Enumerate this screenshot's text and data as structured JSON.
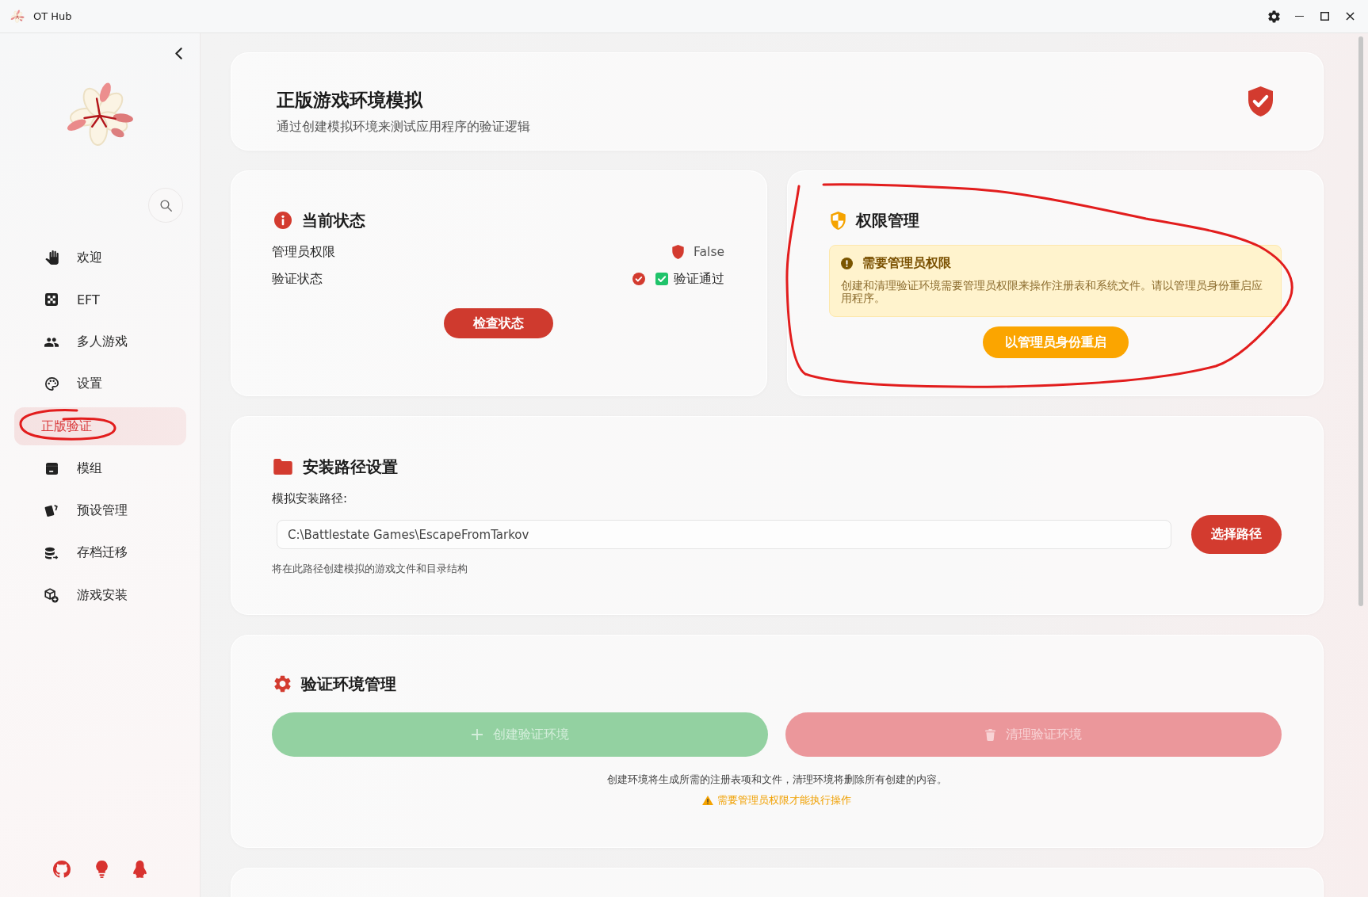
{
  "window": {
    "title": "OT Hub"
  },
  "sidebar": {
    "items": [
      {
        "label": "欢迎",
        "selected": false,
        "circled": false
      },
      {
        "label": "EFT",
        "selected": false,
        "circled": false
      },
      {
        "label": "多人游戏",
        "selected": false,
        "circled": false
      },
      {
        "label": "设置",
        "selected": false,
        "circled": false
      },
      {
        "label": "正版验证",
        "selected": true,
        "circled": true
      },
      {
        "label": "模组",
        "selected": false,
        "circled": false
      },
      {
        "label": "预设管理",
        "selected": false,
        "circled": false
      },
      {
        "label": "存档迁移",
        "selected": false,
        "circled": false
      },
      {
        "label": "游戏安装",
        "selected": false,
        "circled": false
      }
    ]
  },
  "header": {
    "title": "正版游戏环境模拟",
    "subtitle": "通过创建模拟环境来测试应用程序的验证逻辑"
  },
  "status": {
    "title": "当前状态",
    "rows": [
      {
        "kind": "admin",
        "label": "管理员权限",
        "value": "False"
      },
      {
        "kind": "verify",
        "label": "验证状态",
        "value": "验证通过",
        "checked": true
      }
    ],
    "button": "检查状态"
  },
  "permission": {
    "title": "权限管理",
    "circled": true,
    "warning": {
      "title": "需要管理员权限",
      "text": "创建和清理验证环境需要管理员权限来操作注册表和系统文件。请以管理员身份重启应用程序。"
    },
    "button": "以管理员身份重启"
  },
  "install_path": {
    "title": "安装路径设置",
    "label": "模拟安装路径:",
    "value": "C:\\Battlestate Games\\EscapeFromTarkov",
    "button": "选择路径",
    "hint": "将在此路径创建模拟的游戏文件和目录结构"
  },
  "environment": {
    "title": "验证环境管理",
    "buttons": [
      {
        "kind": "create",
        "label": "创建验证环境",
        "disabled": true
      },
      {
        "kind": "clean",
        "label": "清理验证环境",
        "disabled": true
      }
    ],
    "note": "创建环境将生成所需的注册表项和文件，清理环境将删除所有创建的内容。",
    "warning": "需要管理员权限才能执行操作"
  }
}
